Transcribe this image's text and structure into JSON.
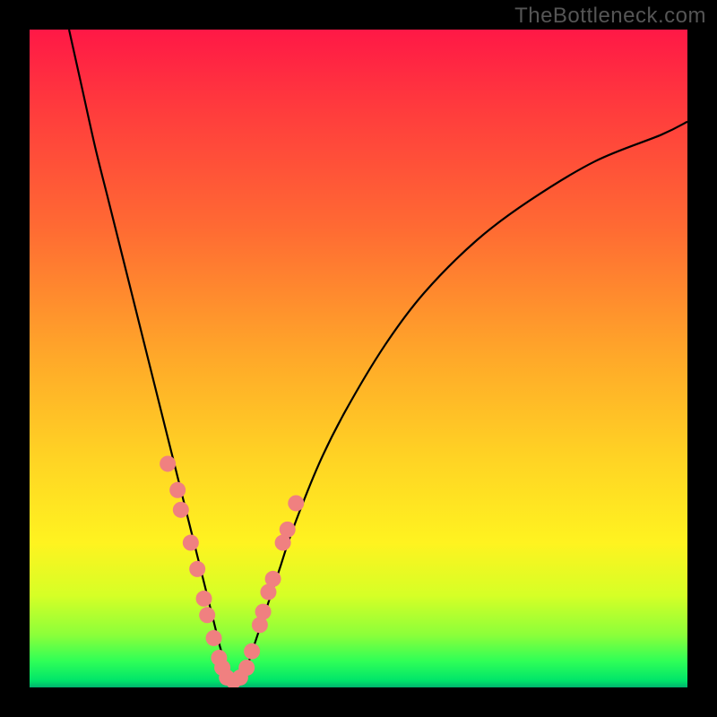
{
  "watermark": "TheBottleneck.com",
  "chart_data": {
    "type": "line",
    "title": "",
    "xlabel": "",
    "ylabel": "",
    "xlim": [
      0,
      100
    ],
    "ylim": [
      0,
      100
    ],
    "series": [
      {
        "name": "bottleneck-curve",
        "x": [
          6,
          8,
          10,
          12,
          14,
          16,
          18,
          20,
          22,
          24,
          25,
          26,
          27,
          28,
          29,
          30,
          31,
          32,
          33,
          34,
          36,
          38,
          40,
          44,
          48,
          54,
          60,
          68,
          76,
          86,
          96,
          100
        ],
        "y": [
          100,
          91,
          82,
          74,
          66,
          58,
          50,
          42,
          34,
          26,
          22,
          18,
          14,
          10,
          6,
          3,
          1,
          1,
          3,
          6,
          12,
          18,
          24,
          34,
          42,
          52,
          60,
          68,
          74,
          80,
          84,
          86
        ]
      }
    ],
    "markers": {
      "name": "highlight-points",
      "x": [
        21.0,
        22.5,
        23.0,
        24.5,
        25.5,
        26.5,
        27.0,
        28.0,
        28.8,
        29.3,
        30.0,
        31.0,
        32.0,
        33.0,
        33.8,
        35.0,
        35.5,
        36.3,
        37.0,
        38.5,
        39.2,
        40.5
      ],
      "y": [
        34.0,
        30.0,
        27.0,
        22.0,
        18.0,
        13.5,
        11.0,
        7.5,
        4.5,
        3.0,
        1.5,
        1.0,
        1.5,
        3.0,
        5.5,
        9.5,
        11.5,
        14.5,
        16.5,
        22.0,
        24.0,
        28.0
      ]
    },
    "gradient_stops": [
      {
        "pos": 0.0,
        "color": "#ff1846"
      },
      {
        "pos": 0.12,
        "color": "#ff3b3d"
      },
      {
        "pos": 0.3,
        "color": "#ff6a33"
      },
      {
        "pos": 0.5,
        "color": "#ffa929"
      },
      {
        "pos": 0.65,
        "color": "#ffd324"
      },
      {
        "pos": 0.78,
        "color": "#fff320"
      },
      {
        "pos": 0.86,
        "color": "#d6ff26"
      },
      {
        "pos": 0.92,
        "color": "#8cff3a"
      },
      {
        "pos": 0.96,
        "color": "#2fff57"
      },
      {
        "pos": 0.99,
        "color": "#00e46a"
      },
      {
        "pos": 1.0,
        "color": "#00b36e"
      }
    ],
    "marker_color": "#f08080",
    "curve_color": "#000000"
  }
}
